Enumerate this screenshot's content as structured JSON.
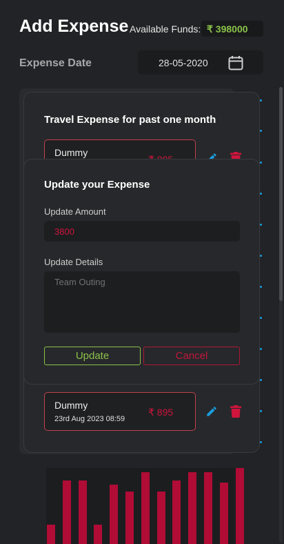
{
  "header": {
    "title": "Add Expense",
    "funds_label": "Available Funds:",
    "funds_value": "₹ 398000"
  },
  "date_row": {
    "label": "Expense Date",
    "value": "28-05-2020"
  },
  "expense_list": {
    "title": "Travel Expense for past one month",
    "items": [
      {
        "name": "Dummy",
        "date": "",
        "amount": "₹ 895"
      },
      {
        "name": "Dummy",
        "date": "23rd Aug 2023  08:59",
        "amount": "₹ 895"
      }
    ]
  },
  "update_dialog": {
    "title": "Update your Expense",
    "amount_label": "Update Amount",
    "amount_value": "3800",
    "details_label": "Update Details",
    "details_placeholder": "Team Outing",
    "update_button": "Update",
    "cancel_button": "Cancel"
  },
  "colors": {
    "accent_green": "#8bc34a",
    "accent_red": "#d0143c",
    "accent_blue": "#1a9de0"
  },
  "chart_data": {
    "type": "bar",
    "values": [
      28,
      92,
      92,
      28,
      86,
      76,
      104,
      76,
      92,
      104,
      104,
      89,
      110
    ],
    "ylim": [
      0,
      110
    ]
  }
}
